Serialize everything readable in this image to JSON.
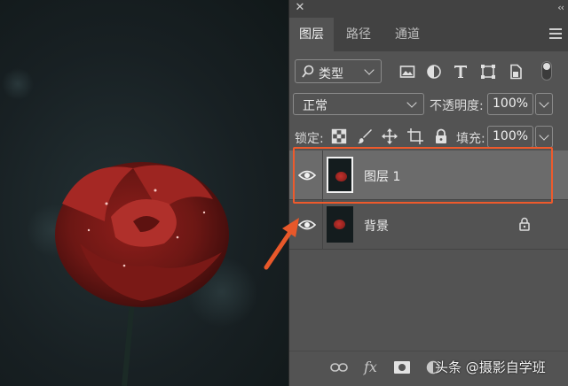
{
  "panel": {
    "close_glyph": "✕",
    "collapse_glyph": "‹‹",
    "tabs": [
      {
        "label": "图层"
      },
      {
        "label": "路径"
      },
      {
        "label": "通道"
      }
    ],
    "menu_icon": "hamburger-icon"
  },
  "filter": {
    "label": "类型",
    "icons": [
      "pixel-layer-filter-icon",
      "adjustment-layer-filter-icon",
      "type-layer-filter-icon",
      "shape-layer-filter-icon",
      "smart-object-filter-icon"
    ]
  },
  "blend": {
    "mode": "正常",
    "opacity_label": "不透明度:",
    "opacity_value": "100%"
  },
  "lock": {
    "label": "锁定:",
    "icons": [
      "lock-transparent-pixels-icon",
      "lock-image-pixels-icon",
      "lock-position-icon",
      "lock-artboard-icon",
      "lock-all-icon"
    ],
    "fill_label": "填充:",
    "fill_value": "100%"
  },
  "layers": [
    {
      "name": "图层 1",
      "visible": true,
      "selected": true
    },
    {
      "name": "背景",
      "visible": true,
      "locked": true
    }
  ],
  "bottom_bar": {
    "icons": [
      "link-layers-icon",
      "fx-icon",
      "layer-mask-icon",
      "adjustment-layer-icon"
    ],
    "fx_label": "fx"
  },
  "watermark": "头条 @摄影自学班",
  "colors": {
    "highlight": "#ee5a2c",
    "arrow": "#e8582a",
    "panel_bg": "#535353",
    "selected_layer": "#6b6b6b"
  }
}
